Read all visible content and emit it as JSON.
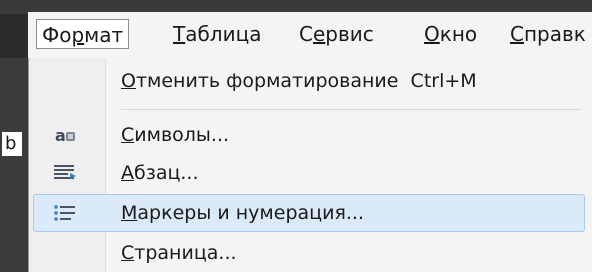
{
  "menubar": {
    "items": [
      {
        "before": "Фо",
        "underline": "р",
        "after": "мат",
        "active": true
      },
      {
        "before": "",
        "underline": "Т",
        "after": "аблица",
        "active": false
      },
      {
        "before": "С",
        "underline": "е",
        "after": "рвис",
        "active": false
      },
      {
        "before": "",
        "underline": "О",
        "after": "кно",
        "active": false
      },
      {
        "before": "",
        "underline": "С",
        "after": "правк",
        "active": false
      }
    ]
  },
  "document": {
    "visible_char": "b"
  },
  "dropdown": {
    "items": [
      {
        "before": "",
        "underline": "О",
        "after": "тменить форматирование",
        "shortcut": "Ctrl+M",
        "icon": "none"
      },
      {
        "before": "",
        "underline": "С",
        "after": "имволы...",
        "shortcut": "",
        "icon": "character-icon"
      },
      {
        "before": "",
        "underline": "А",
        "after": "бзац...",
        "shortcut": "",
        "icon": "paragraph-icon"
      },
      {
        "before": "",
        "underline": "М",
        "after": "аркеры и нумерация...",
        "shortcut": "",
        "icon": "bullets-numbering-icon"
      },
      {
        "before": "",
        "underline": "С",
        "after": "траница...",
        "shortcut": "",
        "icon": "none"
      }
    ]
  }
}
